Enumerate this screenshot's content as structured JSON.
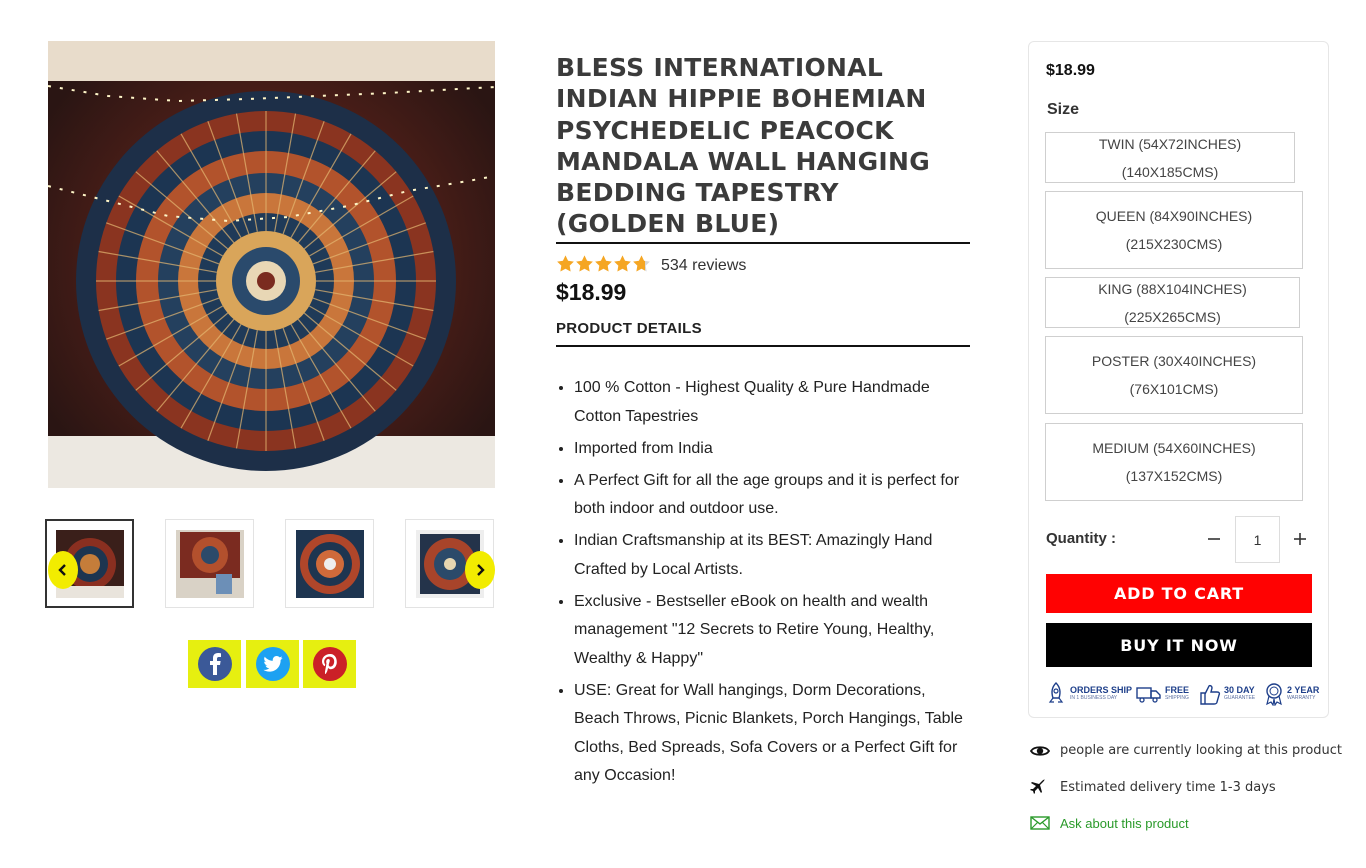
{
  "product": {
    "title": "BLESS INTERNATIONAL INDIAN HIPPIE BOHEMIAN PSYCHEDELIC PEACOCK MANDALA WALL HANGING BEDDING TAPESTRY (GOLDEN BLUE)",
    "rating": 4.7,
    "reviews_text": "534 reviews",
    "price": "$18.99",
    "details_heading": "PRODUCT DETAILS",
    "features": [
      "100 % Cotton - Highest Quality & Pure Handmade Cotton Tapestries",
      "Imported from India",
      "A Perfect Gift for all the age groups and it is perfect for both indoor and outdoor use.",
      "Indian Craftsmanship at its BEST: Amazingly Hand Crafted by Local Artists.",
      "Exclusive - Bestseller eBook on health and wealth management \"12 Secrets to Retire Young, Healthy, Wealthy & Happy\"",
      "USE: Great for Wall hangings, Dorm Decorations, Beach Throws, Picnic Blankets, Porch Hangings, Table Cloths, Bed Spreads, Sofa Covers or a Perfect Gift for any Occasion!"
    ]
  },
  "gallery": {
    "main_image": "mandala-tapestry-photo",
    "thumbnails": [
      "thumb-1",
      "thumb-2",
      "thumb-3",
      "thumb-4"
    ],
    "active_index": 0,
    "share": [
      "facebook-icon",
      "twitter-icon",
      "pinterest-icon"
    ]
  },
  "purchase": {
    "price": "$18.99",
    "size_label": "Size",
    "sizes": [
      "TWIN (54X72INCHES) (140X185CMS)",
      "QUEEN (84X90INCHES) (215X230CMS)",
      "KING (88X104INCHES) (225X265CMS)",
      "POSTER (30X40INCHES) (76X101CMS)",
      "MEDIUM (54X60INCHES) (137X152CMS)"
    ],
    "quantity_label": "Quantity :",
    "quantity": "1",
    "add_to_cart": "ADD TO CART",
    "buy_now": "BUY IT NOW",
    "badges": [
      {
        "title": "ORDERS SHIP",
        "sub": "IN 1 BUSINESS DAY"
      },
      {
        "title": "FREE",
        "sub": "SHIPPING"
      },
      {
        "title": "30 DAY",
        "sub": "GUARANTEE"
      },
      {
        "title": "2 YEAR",
        "sub": "WARRANTY"
      }
    ]
  },
  "info": {
    "viewers": "people are currently looking at this product",
    "delivery": "Estimated delivery time 1-3 days",
    "ask": "Ask about this product"
  },
  "colors": {
    "add_to_cart": "#ff0202",
    "buy_now": "#000000",
    "share_bg": "#e6ef10",
    "star": "#f5a623",
    "ask_link": "#2a9a2a"
  }
}
